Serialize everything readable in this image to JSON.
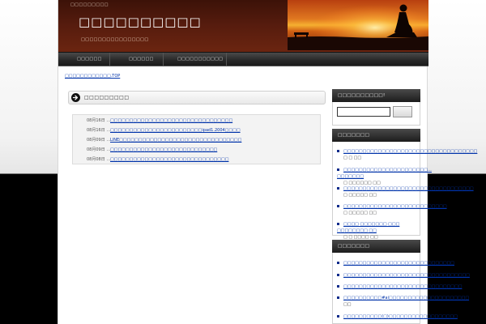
{
  "header": {
    "top_tagline": "□□□□□□□□□",
    "site_title": "□□□□□□□□□□",
    "site_description": "□□□□□□□□□□□□□□□□"
  },
  "nav": {
    "items": [
      {
        "label": "□□□□□□"
      },
      {
        "label": "□□□□□□"
      },
      {
        "label": "□□□□□□□□□□□"
      }
    ]
  },
  "breadcrumb": "□□□□□□□□□□□□.TOP",
  "main": {
    "section_title": "□□□□□□□□□",
    "news": [
      {
        "date": "08月16日 …",
        "title": "□□□□□□□□□□□□□□□□□□□□□□□□□□□□□□□□"
      },
      {
        "date": "08月16日 …",
        "title": "□□□□□□□□□□□□□□□□□□□□□□□□ipad1.2004□□□□"
      },
      {
        "date": "08月09日 …",
        "title": "LINE□□□□□□□□□□□□□□□□□□□□□□□□□□□□□□□□"
      },
      {
        "date": "08月09日 …",
        "title": "□□□□□□□□□□□□□□□□□□□□□□□□□□□□"
      },
      {
        "date": "08月08日 …",
        "title": "□□□□□□□□□□□□□□□□□□□□□□□□□□□□□□□"
      }
    ]
  },
  "sidebar": {
    "search_title": "□□□□□□□□□□!",
    "search_input_value": "",
    "search_button_label": "",
    "recent_title": "□□□□□□□",
    "recent": [
      {
        "link": "□□□□□□□□□□□□□□□□□□□□□□□□□□□□□□□□□□□",
        "tail": "□ □ □□"
      },
      {
        "link": "□□□□□□□□□□□□□□□□□□□□□□…□□□□□□□",
        "tail": "□ □□□□□□ □□"
      },
      {
        "link": "□□□□□□□□□□□□□□□□□□□□□□□□□□□□□□□□□□",
        "tail": "□ □□□□□ □□"
      },
      {
        "link": "□□□□□□□□□□□□□□□□□□□□□□□□□□□",
        "tail": "□ □□□□□ □□"
      },
      {
        "link": "□□□□ □□□□□□□ □□□ □□□□□□□□ □□",
        "tail": "□ □ □□□□ □□"
      }
    ],
    "category_title": "□□□□□□□",
    "categories": [
      {
        "link": "□□□□□□□□□□□□□□□□□□□□□□□□□□□□□"
      },
      {
        "link": "□□□□□□□□□□□□□□□□□□□□□□□□□□□□□□□□□"
      },
      {
        "link": "□□□□□□□□□□□□□□□□□□□□□□□□□□□□□□□"
      },
      {
        "link": "□□□□□□□□□□#ai□□□□□□□□□□□□□□□□□□□□□",
        "tail": "□□"
      },
      {
        "link": "□□□□□□□□□□(□)□□□□□□□□□□□□□□□□□□"
      }
    ]
  },
  "colors": {
    "header_bg": "#571c0e",
    "nav_bg": "#2a2a2a",
    "link": "#0033aa",
    "sidebar_head_bg": "#2c2c2c",
    "page_bg_bottom": "#000000"
  }
}
